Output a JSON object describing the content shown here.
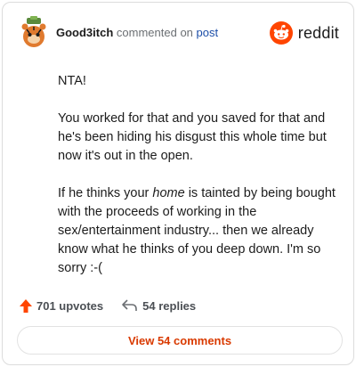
{
  "header": {
    "username": "Good3itch",
    "action_text": "commented on",
    "post_link": "post",
    "brand_name": "reddit",
    "brand_color": "#ff4500",
    "avatar_icon": "snoo-avatar-icon"
  },
  "comment": {
    "paragraphs": [
      "NTA!",
      "You worked for that and you saved for that and he's been hiding his disgust this whole time but now it's out in the open."
    ],
    "p3_before": "If he thinks your ",
    "p3_emph": "home",
    "p3_after": " is tainted by being bought with the proceeds of working in the sex/entertainment industry... then we already know what he thinks of you deep down. I'm so sorry :-("
  },
  "stats": {
    "upvotes": "701 upvotes",
    "replies": "54 replies",
    "upvote_icon": "upvote-arrow-icon",
    "reply_icon": "reply-arrow-icon"
  },
  "footer": {
    "view_comments": "View 54 comments"
  }
}
